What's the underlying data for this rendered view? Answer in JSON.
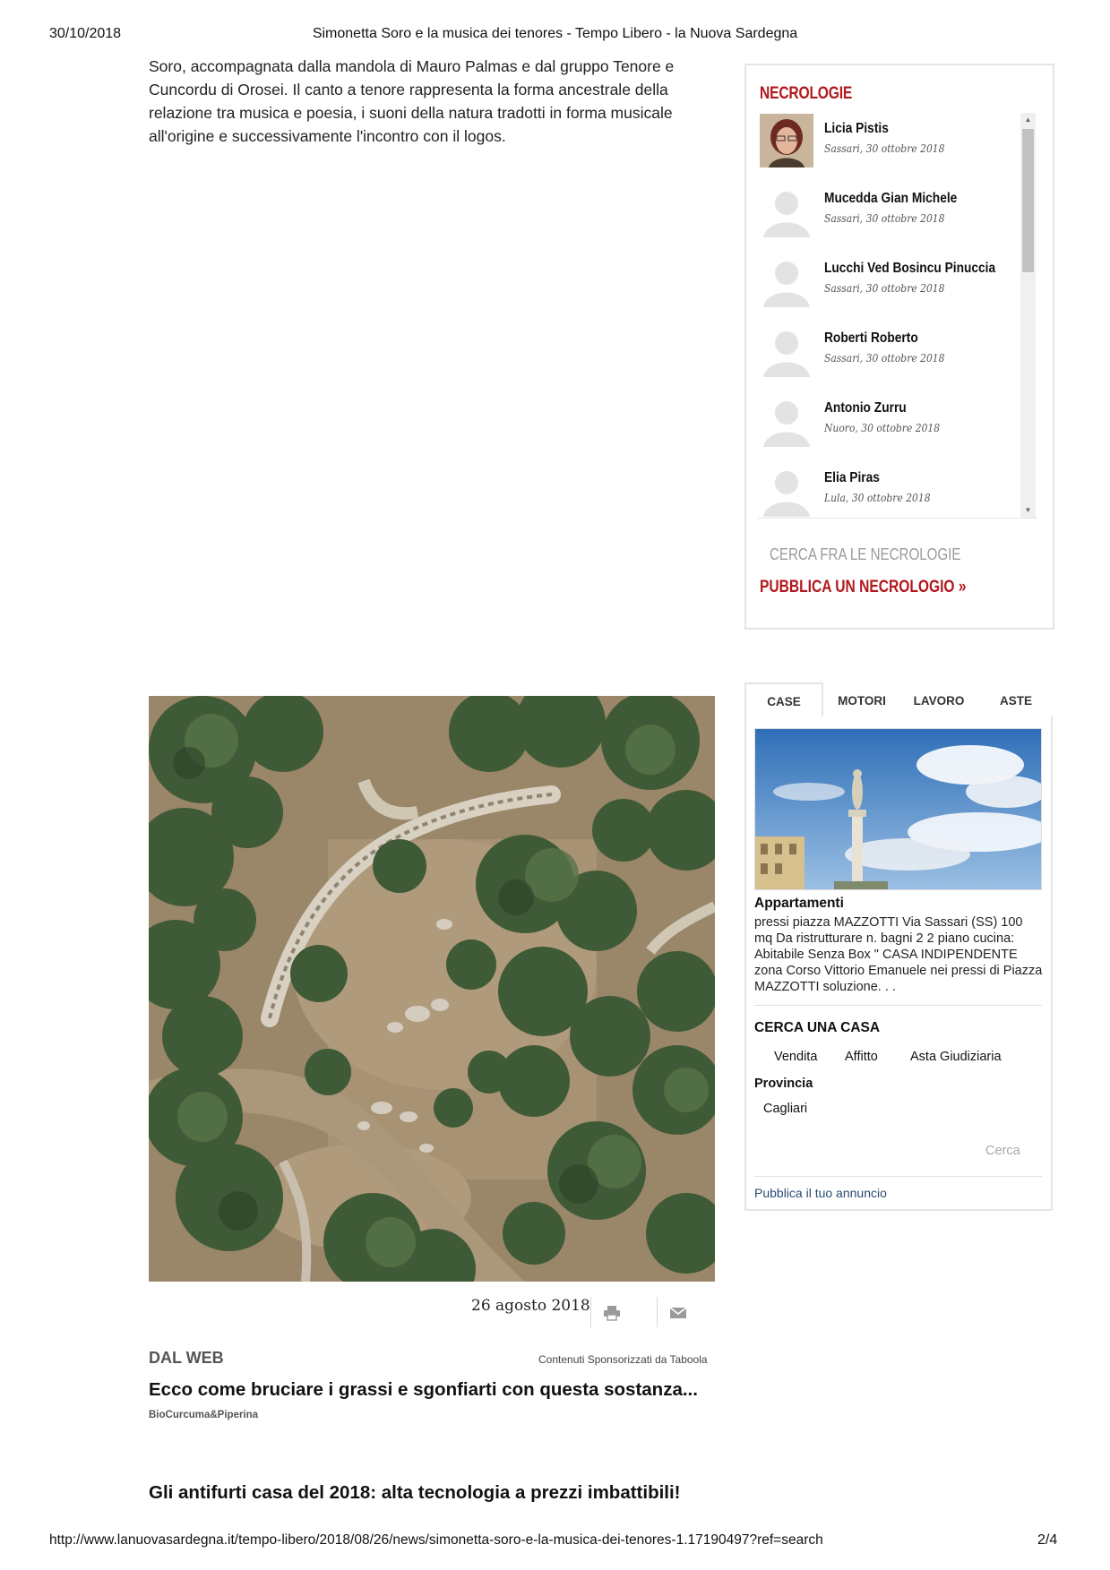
{
  "print_header": {
    "date": "30/10/2018",
    "title": "Simonetta Soro e la musica dei tenores - Tempo Libero - la Nuova Sardegna"
  },
  "article": {
    "paragraph_lines": [
      "Soro, accompagnata dalla mandola di Mauro Palmas e dal gruppo Tenore e",
      "Cuncordu di Orosei. Il canto a tenore rappresenta la forma ancestrale della",
      "relazione tra musica e poesia, i suoni della natura tradotti in forma musicale",
      "all'origine e successivamente l'incontro con il logos."
    ],
    "date": "26 agosto 2018",
    "print_icon": "printer-icon",
    "mail_icon": "envelope-icon"
  },
  "dal_web": {
    "heading": "DAL WEB",
    "sponsor": "Contenuti Sponsorizzati da Taboola",
    "headline": "Ecco come bruciare i grassi e sgonfiarti con questa sostanza...",
    "source": "BioCurcuma&Piperina",
    "headline2": "Gli antifurti casa del 2018: alta tecnologia a prezzi imbattibili!"
  },
  "necrologie": {
    "title": "NECROLOGIE",
    "items": [
      {
        "name": "Licia Pistis",
        "place_date": "Sassari, 30 ottobre 2018",
        "photo": "portrait"
      },
      {
        "name": "Mucedda Gian Michele",
        "place_date": "Sassari, 30 ottobre 2018",
        "photo": "placeholder"
      },
      {
        "name": "Lucchi Ved Bosincu Pinuccia",
        "place_date": "Sassari, 30 ottobre 2018",
        "photo": "placeholder"
      },
      {
        "name": "Roberti Roberto",
        "place_date": "Sassari, 30 ottobre 2018",
        "photo": "placeholder"
      },
      {
        "name": "Antonio Zurru",
        "place_date": "Nuoro, 30 ottobre 2018",
        "photo": "placeholder"
      },
      {
        "name": "Elia Piras",
        "place_date": "Lula, 30 ottobre 2018",
        "photo": "placeholder"
      }
    ],
    "search_label": "CERCA FRA LE NECROLOGIE",
    "publish_label": "PUBBLICA UN NECROLOGIO »"
  },
  "annunci": {
    "tabs": [
      "CASE",
      "MOTORI",
      "LAVORO",
      "ASTE"
    ],
    "active_tab": "CASE",
    "listing": {
      "category": "Appartamenti",
      "description": "pressi piazza MAZZOTTI Via Sassari (SS) 100 mq Da ristrutturare n. bagni 2 2 piano cucina: Abitabile Senza Box \" CASA INDIPENDENTE zona Corso Vittorio Emanuele nei pressi di Piazza MAZZOTTI soluzione. . ."
    },
    "search_heading": "CERCA UNA CASA",
    "options": [
      "Vendita",
      "Affitto",
      "Asta Giudiziaria"
    ],
    "province_label": "Provincia",
    "province_value": "Cagliari",
    "search_button": "Cerca",
    "publish_link": "Pubblica il tuo annuncio"
  },
  "print_footer": {
    "url": "http://www.lanuovasardegna.it/tempo-libero/2018/08/26/news/simonetta-soro-e-la-musica-dei-tenores-1.17190497?ref=search",
    "page": "2/4"
  },
  "colors": {
    "brand_red": "#b1181c",
    "link_blue": "#2a4a74",
    "border_grey": "#e4e4e4"
  }
}
